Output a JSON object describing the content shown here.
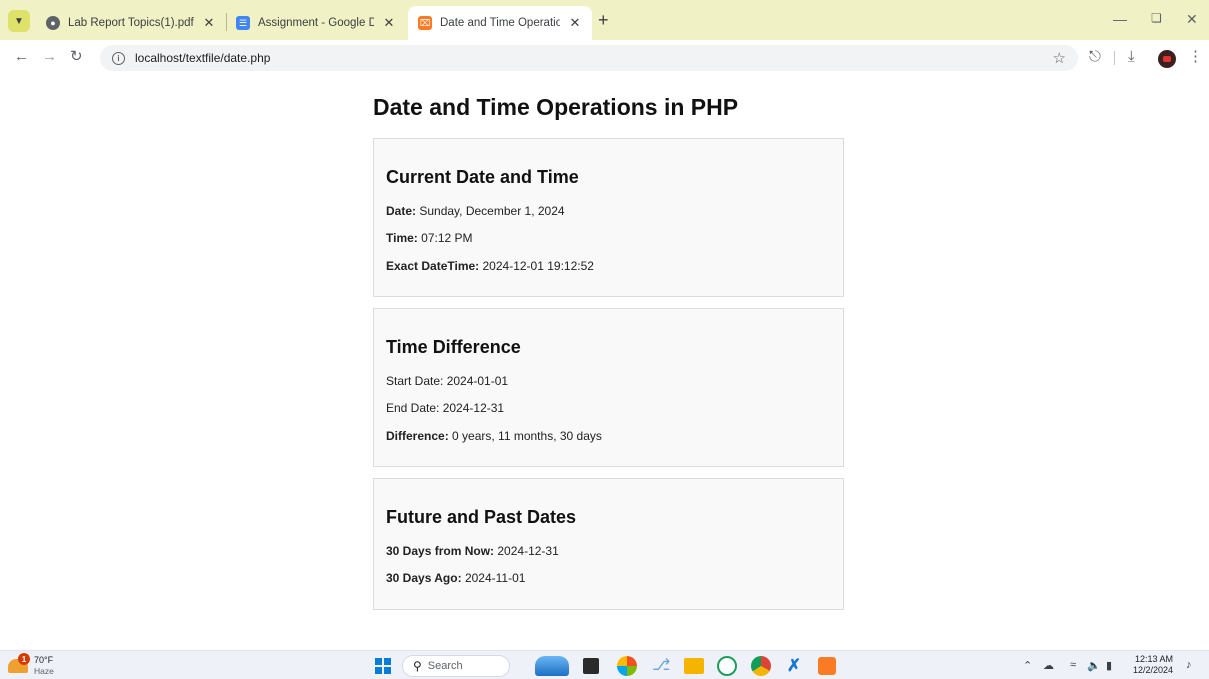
{
  "browser": {
    "tabs": [
      {
        "title": "Lab Report Topics(1).pdf",
        "icon": "globe-icon",
        "active": false
      },
      {
        "title": "Assignment - Google Docs",
        "icon": "google-docs-icon",
        "active": false
      },
      {
        "title": "Date and Time Operations",
        "icon": "xampp-icon",
        "active": true
      }
    ],
    "new_tab": "+",
    "url": "localhost/textfile/date.php"
  },
  "page": {
    "title": "Date and Time Operations in PHP",
    "current": {
      "heading": "Current Date and Time",
      "date_label": "Date:",
      "date_value": "Sunday, December 1, 2024",
      "time_label": "Time:",
      "time_value": "07:12 PM",
      "exact_label": "Exact DateTime:",
      "exact_value": "2024-12-01 19:12:52"
    },
    "difference": {
      "heading": "Time Difference",
      "start": "Start Date: 2024-01-01",
      "end": "End Date: 2024-12-31",
      "diff_label": "Difference:",
      "diff_value": "0 years, 11 months, 30 days"
    },
    "future_past": {
      "heading": "Future and Past Dates",
      "future_label": "30 Days from Now:",
      "future_value": "2024-12-31",
      "past_label": "30 Days Ago:",
      "past_value": "2024-11-01"
    }
  },
  "taskbar": {
    "weather_temp": "70°F",
    "weather_cond": "Haze",
    "weather_badge": "1",
    "search_label": "Search",
    "clock_time": "12:13 AM",
    "clock_date": "12/2/2024"
  },
  "colors": {
    "tab_strip": "#f0f1c4",
    "card_bg": "#f9f9f9",
    "card_border": "#dcdcdc",
    "taskbar": "#eef2f8"
  }
}
